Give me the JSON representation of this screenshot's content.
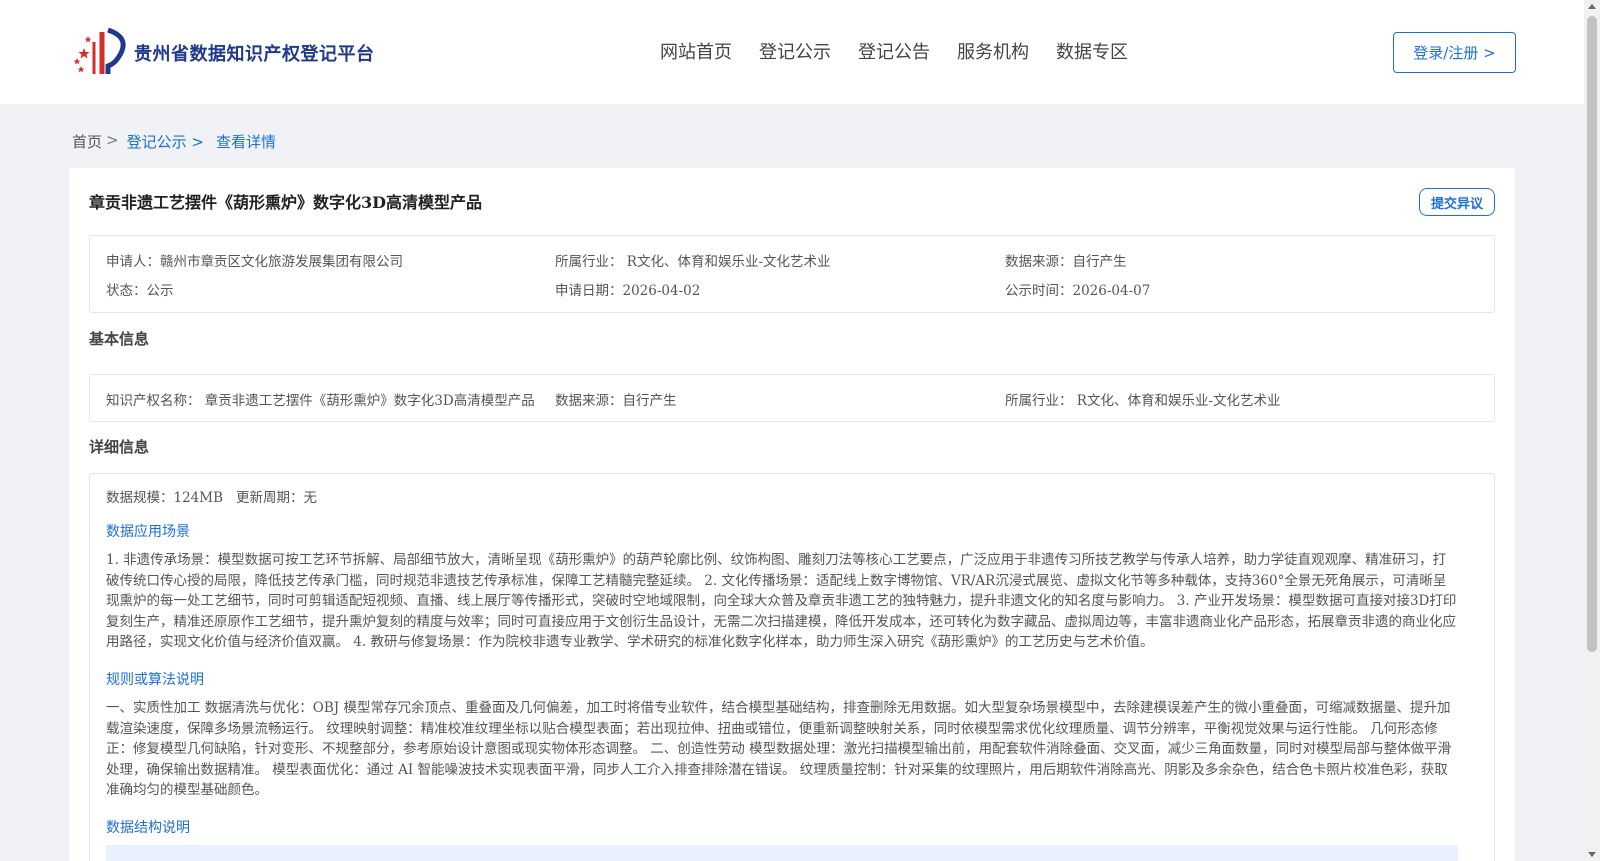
{
  "header": {
    "site_name": "贵州省数据知识产权登记平台",
    "nav": [
      "网站首页",
      "登记公示",
      "登记公告",
      "服务机构",
      "数据专区"
    ],
    "login_label": "登录/注册 >"
  },
  "breadcrumb": {
    "home": "首页",
    "sep": ">",
    "items": [
      "登记公示 >",
      "查看详情"
    ]
  },
  "product": {
    "title": "章贡非遗工艺摆件《葫形熏炉》数字化3D高清模型产品",
    "objection_label": "提交异议",
    "summary": {
      "applicant": "申请人：赣州市章贡区文化旅游发展集团有限公司",
      "industry": "所属行业： R文化、体育和娱乐业-文化艺术业",
      "data_source": "数据来源：自行产生",
      "status": "状态：公示",
      "apply_date": "申请日期：2026-04-02",
      "publicity_date": "公示时间：2026-04-07"
    }
  },
  "basic": {
    "section_title": "基本信息",
    "ip_name": "知识产权名称： 章贡非遗工艺摆件《葫形熏炉》数字化3D高清模型产品",
    "data_source": "数据来源：自行产生",
    "industry": "所属行业： R文化、体育和娱乐业-文化艺术业"
  },
  "detail": {
    "section_title": "详细信息",
    "scale": "数据规模：124MB",
    "update_cycle": "更新周期：无",
    "scenario_heading": "数据应用场景",
    "scenario_text": "1. 非遗传承场景：模型数据可按工艺环节拆解、局部细节放大，清晰呈现《葫形熏炉》的葫芦轮廓比例、纹饰构图、雕刻刀法等核心工艺要点，广泛应用于非遗传习所技艺教学与传承人培养，助力学徒直观观摩、精准研习，打破传统口传心授的局限，降低技艺传承门槛，同时规范非遗技艺传承标准，保障工艺精髓完整延续。 2. 文化传播场景：适配线上数字博物馆、VR/AR沉浸式展览、虚拟文化节等多种载体，支持360°全景无死角展示，可清晰呈现熏炉的每一处工艺细节，同时可剪辑适配短视频、直播、线上展厅等传播形式，突破时空地域限制，向全球大众普及章贡非遗工艺的独特魅力，提升非遗文化的知名度与影响力。 3. 产业开发场景：模型数据可直接对接3D打印复刻生产，精准还原原作工艺细节，提升熏炉复刻的精度与效率；同时可直接应用于文创衍生品设计，无需二次扫描建模，降低开发成本，还可转化为数字藏品、虚拟周边等，丰富非遗商业化产品形态，拓展章贡非遗的商业化应用路径，实现文化价值与经济价值双赢。 4. 教研与修复场景：作为院校非遗专业教学、学术研究的标准化数字化样本，助力师生深入研究《葫形熏炉》的工艺历史与艺术价值。",
    "algorithm_heading": "规则或算法说明",
    "algorithm_text": "一、实质性加工 数据清洗与优化：OBJ 模型常存冗余顶点、重叠面及几何偏差，加工时将借专业软件，结合模型基础结构，排查删除无用数据。如大型复杂场景模型中，去除建模误差产生的微小重叠面，可缩减数据量、提升加载渲染速度，保障多场景流畅运行。 纹理映射调整：精准校准纹理坐标以贴合模型表面；若出现拉伸、扭曲或错位，便重新调整映射关系，同时依模型需求优化纹理质量、调节分辨率，平衡视觉效果与运行性能。 几何形态修正：修复模型几何缺陷，针对变形、不规整部分，参考原始设计意图或现实物体形态调整。 二、创造性劳动 模型数据处理：激光扫描模型输出前，用配套软件消除叠面、交叉面，减少三角面数量，同时对模型局部与整体做平滑处理，确保输出数据精准。 模型表面优化：通过 AI 智能噪波技术实现表面平滑，同步人工介入排查排除潜在错误。 纹理质量控制：针对采集的纹理照片，用后期软件消除高光、阴影及多余杂色，结合色卡照片校准色彩，获取准确均匀的模型基础颜色。",
    "structure_heading": "数据结构说明"
  }
}
